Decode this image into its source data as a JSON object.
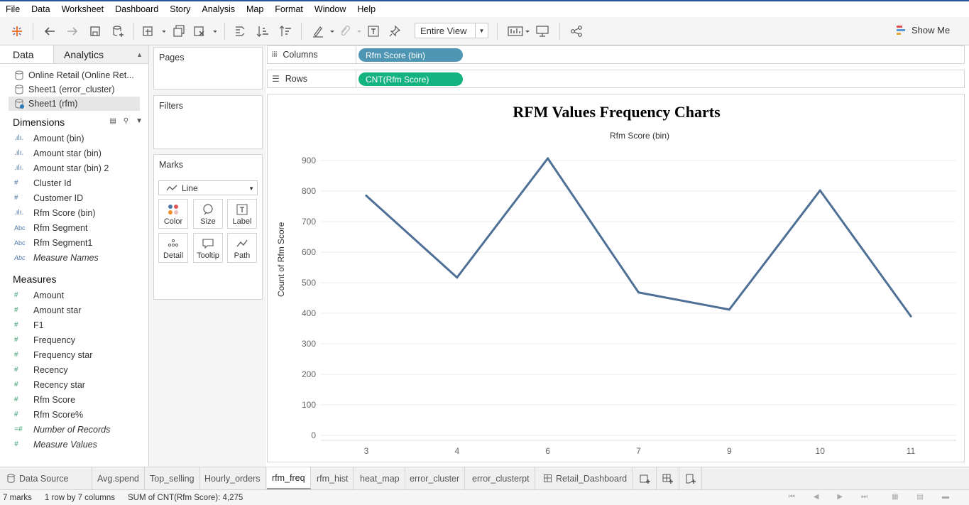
{
  "menu": [
    "File",
    "Data",
    "Worksheet",
    "Dashboard",
    "Story",
    "Analysis",
    "Map",
    "Format",
    "Window",
    "Help"
  ],
  "toolbar": {
    "fit": "Entire View",
    "show_me": "Show Me"
  },
  "data_pane": {
    "tabs": [
      "Data",
      "Analytics"
    ],
    "datasources": [
      "Online Retail (Online Ret...",
      "Sheet1 (error_cluster)",
      "Sheet1 (rfm)"
    ],
    "dimensions_header": "Dimensions",
    "dimensions": [
      {
        "label": "Amount (bin)",
        "icon": ".ılı."
      },
      {
        "label": "Amount star (bin)",
        "icon": ".ılı."
      },
      {
        "label": "Amount star (bin) 2",
        "icon": ".ılı."
      },
      {
        "label": "Cluster Id",
        "icon": "#"
      },
      {
        "label": "Customer ID",
        "icon": "#"
      },
      {
        "label": "Rfm Score (bin)",
        "icon": ".ılı."
      },
      {
        "label": "Rfm Segment",
        "icon": "Abc"
      },
      {
        "label": "Rfm Segment1",
        "icon": "Abc"
      },
      {
        "label": "Measure Names",
        "icon": "Abc"
      }
    ],
    "measures_header": "Measures",
    "measures": [
      {
        "label": "Amount",
        "icon": "#"
      },
      {
        "label": "Amount star",
        "icon": "#"
      },
      {
        "label": "F1",
        "icon": "#"
      },
      {
        "label": "Frequency",
        "icon": "#"
      },
      {
        "label": "Frequency star",
        "icon": "#"
      },
      {
        "label": "Recency",
        "icon": "#"
      },
      {
        "label": "Recency star",
        "icon": "#"
      },
      {
        "label": "Rfm Score",
        "icon": "#"
      },
      {
        "label": "Rfm Score%",
        "icon": "#"
      },
      {
        "label": "Number of Records",
        "icon": "=#"
      },
      {
        "label": "Measure Values",
        "icon": "#"
      }
    ]
  },
  "cards": {
    "pages": "Pages",
    "filters": "Filters",
    "marks": "Marks",
    "mark_type": "Line",
    "buttons": [
      "Color",
      "Size",
      "Label",
      "Detail",
      "Tooltip",
      "Path"
    ]
  },
  "shelves": {
    "columns_label": "Columns",
    "columns_pill": "Rfm Score (bin)",
    "rows_label": "Rows",
    "rows_pill": "CNT(Rfm Score)"
  },
  "chart_data": {
    "type": "line",
    "title": "RFM Values Frequency Charts",
    "xlabel": "Rfm Score (bin)",
    "ylabel": "Count of Rfm Score",
    "categories": [
      "3",
      "4",
      "6",
      "7",
      "9",
      "10",
      "11"
    ],
    "values": [
      785,
      517,
      907,
      468,
      412,
      802,
      390
    ],
    "ylim": [
      0,
      900
    ],
    "yticks": [
      0,
      100,
      200,
      300,
      400,
      500,
      600,
      700,
      800,
      900
    ],
    "line_color": "#4e6f96",
    "grid": true
  },
  "sheets": {
    "data_source": "Data Source",
    "tabs": [
      "Avg.spend",
      "Top_selling",
      "Hourly_orders",
      "rfm_freq",
      "rfm_hist",
      "heat_map",
      "error_cluster",
      "error_clusterpt",
      "Retail_Dashboard"
    ],
    "active": "rfm_freq"
  },
  "status": {
    "marks": "7 marks",
    "dims": "1 row by 7 columns",
    "sum": "SUM of CNT(Rfm Score): 4,275"
  }
}
